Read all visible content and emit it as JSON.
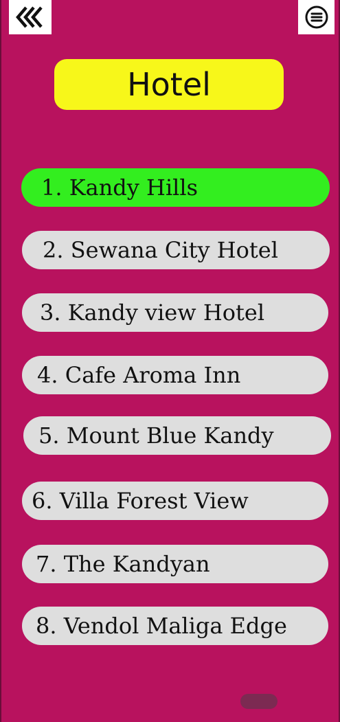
{
  "colors": {
    "background": "#b8125e",
    "title_bg": "#f7f71a",
    "item_bg": "#dedede",
    "active_bg": "#33ee1f",
    "home_indicator": "#7c2a52"
  },
  "header": {
    "back_icon": "triple-chevron-left-icon",
    "menu_icon": "hamburger-circle-icon"
  },
  "title": "Hotel",
  "hotels": [
    {
      "label": "1. Kandy Hills",
      "active": true
    },
    {
      "label": "2. Sewana City Hotel",
      "active": false
    },
    {
      "label": "3. Kandy view Hotel",
      "active": false
    },
    {
      "label": "4. Cafe Aroma Inn",
      "active": false
    },
    {
      "label": "5. Mount Blue Kandy",
      "active": false
    },
    {
      "label": "6. Villa Forest View",
      "active": false
    },
    {
      "label": "7. The Kandyan",
      "active": false
    },
    {
      "label": "8. Vendol Maliga Edge",
      "active": false
    }
  ]
}
